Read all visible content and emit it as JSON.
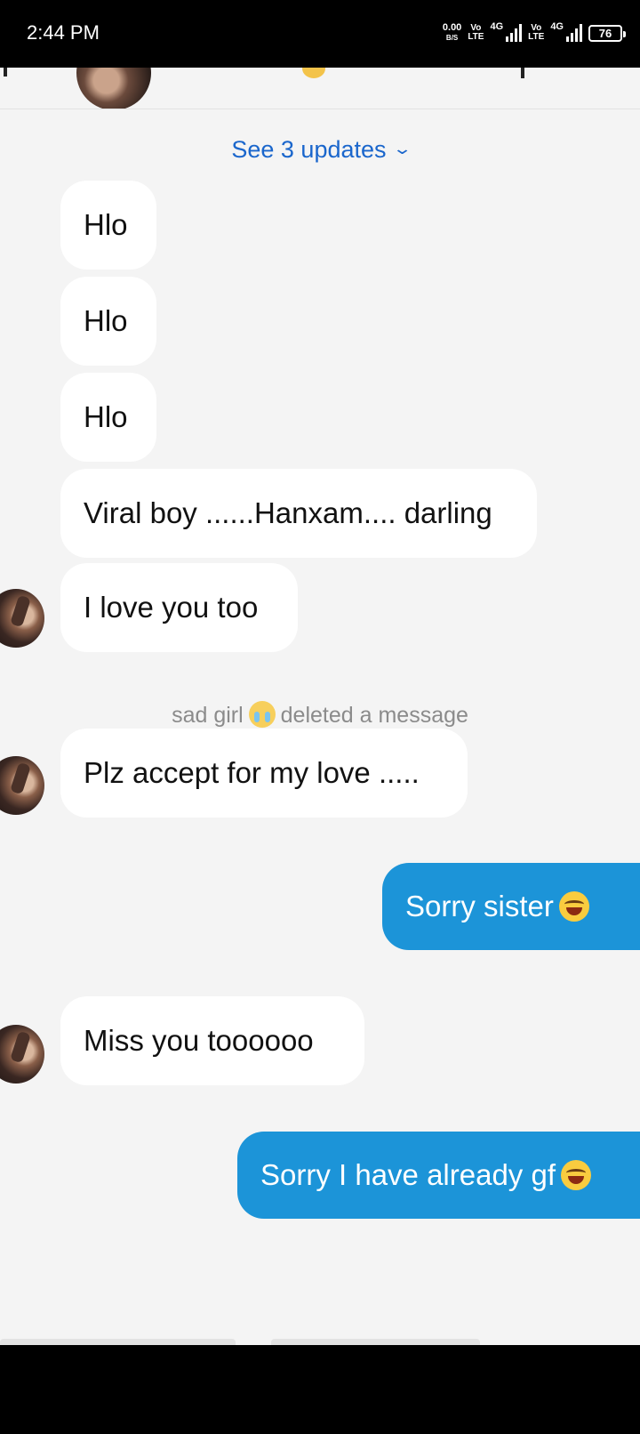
{
  "status_bar": {
    "time": "2:44 PM",
    "net_speed_value": "0.00",
    "net_speed_unit": "B/S",
    "sim1_volte_top": "Vo",
    "sim1_volte_bottom": "LTE",
    "sim1_gen": "4G",
    "sim2_volte_top": "Vo",
    "sim2_volte_bottom": "LTE",
    "sim2_gen": "4G",
    "battery": "76"
  },
  "conversation": {
    "updates_link": "See 3 updates",
    "updates_icon": "chevron-down-icon",
    "messages": [
      {
        "text": "Hlo"
      },
      {
        "text": "Hlo"
      },
      {
        "text": "Hlo"
      },
      {
        "text": "Viral boy ......Hanxam.... darling"
      },
      {
        "text": "I love you too"
      },
      {
        "text": "Plz accept for my love ....."
      },
      {
        "text": "Sorry sister"
      },
      {
        "text": "Miss you toooooo"
      },
      {
        "text": "Sorry I have already gf"
      }
    ],
    "deleted_notice": {
      "user": "sad girl",
      "action": "deleted a message"
    }
  },
  "colors": {
    "background": "#f4f4f4",
    "incoming_bubble": "#ffffff",
    "outgoing_bubble": "#1c94d8",
    "link": "#1a66cc",
    "system_text": "#8b8b8b"
  }
}
